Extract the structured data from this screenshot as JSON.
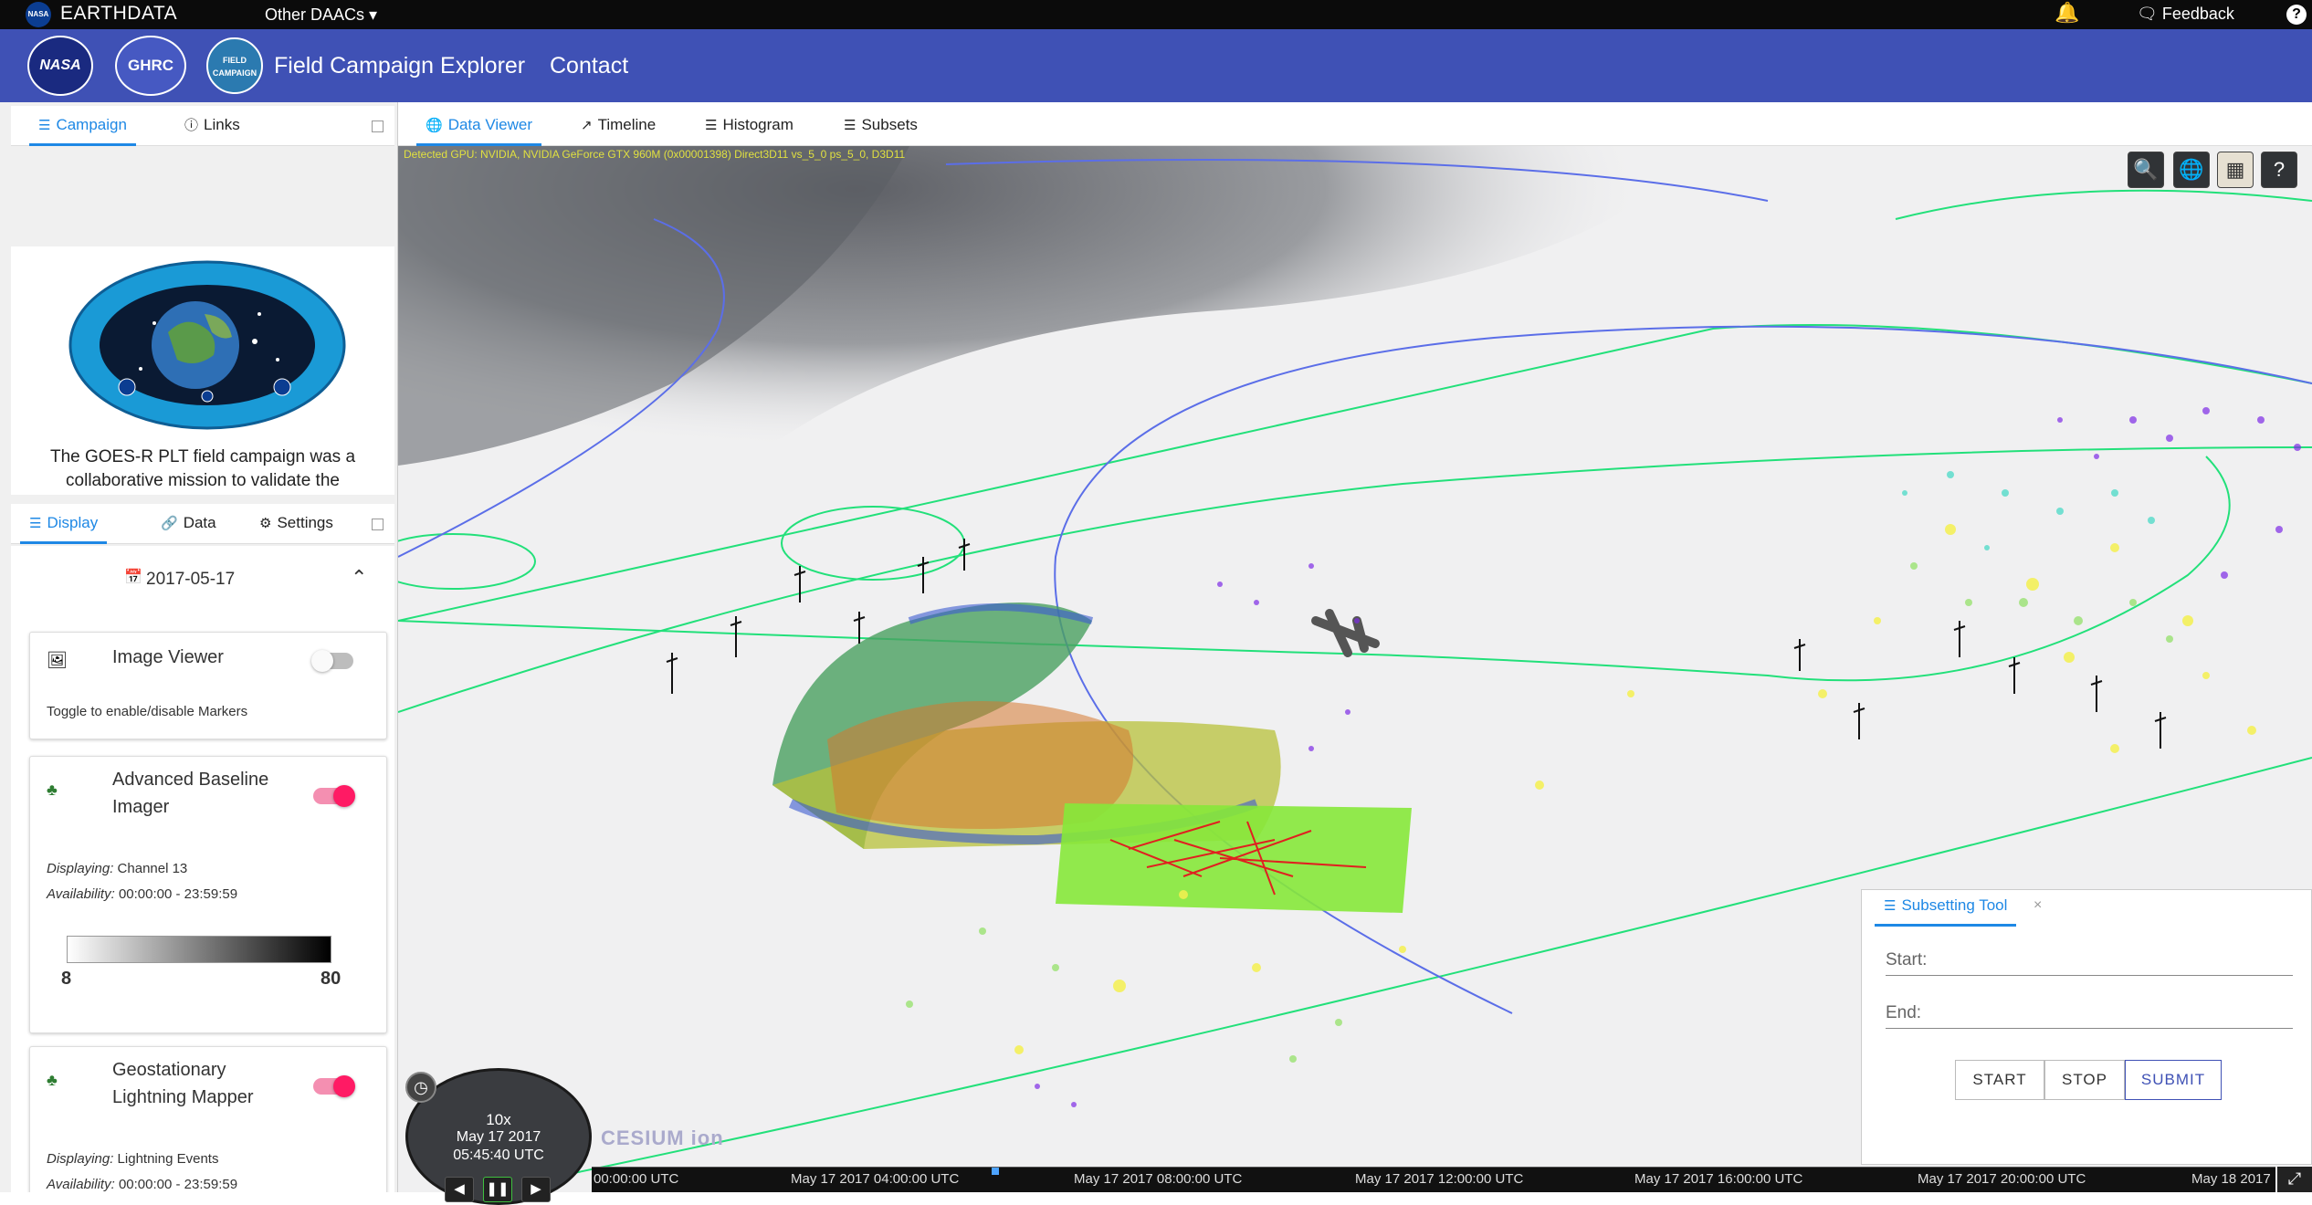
{
  "topbar": {
    "earthdata": "EARTHDATA",
    "other_daacs": "Other DAACs ▾",
    "feedback": "Feedback"
  },
  "header": {
    "app_title": "Field Campaign Explorer",
    "contact": "Contact"
  },
  "left_top_tabs": {
    "campaign": "Campaign",
    "links": "Links"
  },
  "campaign": {
    "description": "The GOES-R PLT field campaign was a collaborative mission to validate the"
  },
  "display_tabs": {
    "display": "Display",
    "data": "Data",
    "settings": "Settings"
  },
  "display": {
    "date": "2017-05-17",
    "image_viewer": {
      "title": "Image Viewer",
      "note": "Toggle to enable/disable Markers",
      "enabled": false
    },
    "abi": {
      "title": "Advanced Baseline Imager",
      "displaying_label": "Displaying:",
      "displaying": "Channel 13",
      "availability_label": "Availability:",
      "availability": "00:00:00 - 23:59:59",
      "scale_min": "8",
      "scale_max": "80",
      "enabled": true
    },
    "glm": {
      "title": "Geostationary Lightning Mapper",
      "displaying_label": "Displaying:",
      "displaying": "Lightning Events",
      "availability_label": "Availability:",
      "availability": "00:00:00 - 23:59:59",
      "enabled": true
    }
  },
  "main_tabs": {
    "data_viewer": "Data Viewer",
    "timeline": "Timeline",
    "histogram": "Histogram",
    "subsets": "Subsets"
  },
  "viewer": {
    "gpu_info": "Detected GPU: NVIDIA, NVIDIA GeForce GTX 960M (0x00001398) Direct3D11 vs_5_0 ps_5_0, D3D11",
    "tools": [
      "search-icon",
      "globe-icon",
      "map-layers-icon",
      "help-icon"
    ]
  },
  "clock": {
    "speed": "10x",
    "date": "May 17 2017",
    "time": "05:45:40 UTC"
  },
  "cesium": "CESIUM ion",
  "timeline": {
    "labels": [
      "00:00:00 UTC",
      "May 17 2017 04:00:00 UTC",
      "May 17 2017 08:00:00 UTC",
      "May 17 2017 12:00:00 UTC",
      "May 17 2017 16:00:00 UTC",
      "May 17 2017 20:00:00 UTC",
      "May 18 2017"
    ]
  },
  "subset": {
    "title": "Subsetting Tool",
    "start_label": "Start:",
    "end_label": "End:",
    "start_btn": "START",
    "stop_btn": "STOP",
    "submit_btn": "SUBMIT"
  },
  "colors": {
    "header_blue": "#3f51b5",
    "accent": "#1e88e5",
    "toggle_on": "#ff1a64",
    "flight_track_green": "#22e07a",
    "flight_track_blue": "#5b6ee8"
  }
}
